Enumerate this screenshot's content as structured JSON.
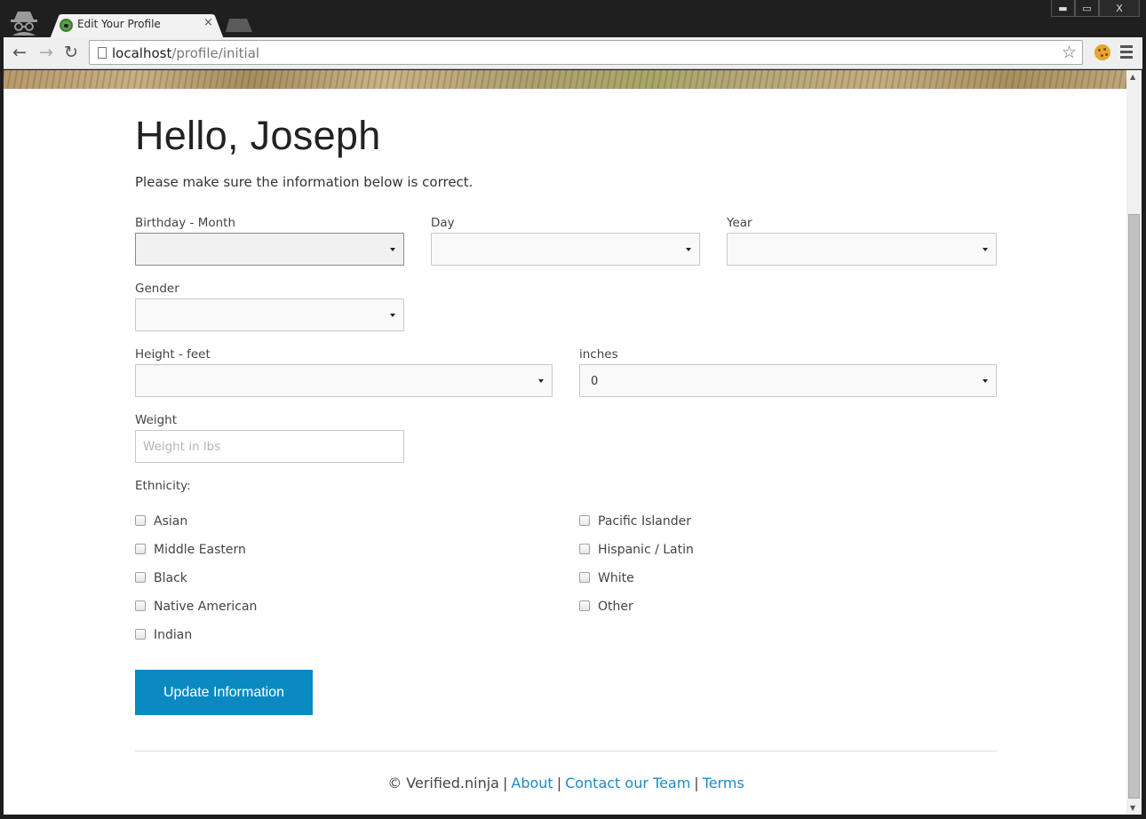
{
  "browser": {
    "tab_title": "Edit Your Profile",
    "tab_close": "×",
    "url_host": "localhost",
    "url_path": "/profile/initial",
    "window_buttons": {
      "minimize": "▬",
      "maximize": "▭",
      "close": "X"
    }
  },
  "page": {
    "greeting": "Hello, Joseph",
    "lead": "Please make sure the information below is correct.",
    "birthday_month_label": "Birthday - Month",
    "birthday_month_value": "",
    "day_label": "Day",
    "day_value": "",
    "year_label": "Year",
    "year_value": "",
    "gender_label": "Gender",
    "gender_value": "",
    "height_feet_label": "Height - feet",
    "height_feet_value": "",
    "height_inches_label": "inches",
    "height_inches_value": "0",
    "weight_label": "Weight",
    "weight_placeholder": "Weight in lbs",
    "ethnicity_label": "Ethnicity:",
    "ethnicity_left": [
      "Asian",
      "Middle Eastern",
      "Black",
      "Native American",
      "Indian"
    ],
    "ethnicity_right": [
      "Pacific Islander",
      "Hispanic / Latin",
      "White",
      "Other"
    ],
    "submit_label": "Update Information"
  },
  "footer": {
    "copyright": "© Verified.ninja",
    "about": "About",
    "contact": "Contact our Team",
    "terms": "Terms",
    "separator": "|"
  },
  "colors": {
    "accent": "#0b8ac2",
    "link": "#1e88c7"
  }
}
